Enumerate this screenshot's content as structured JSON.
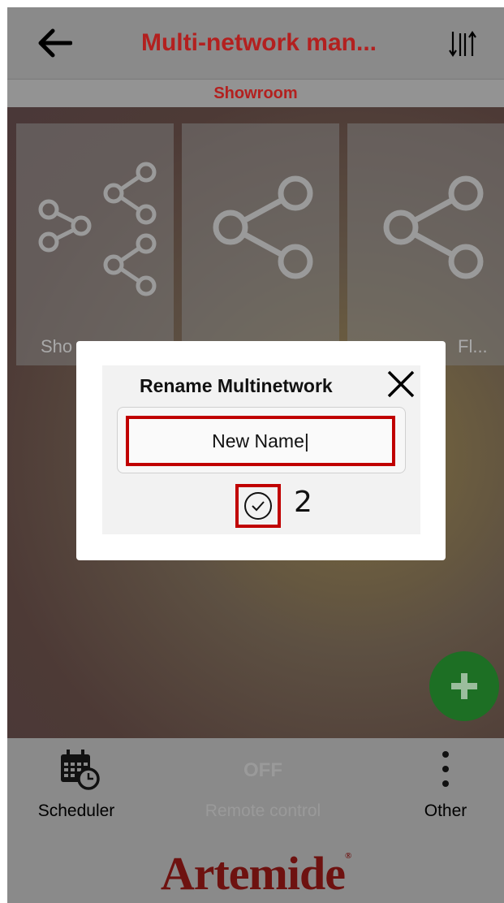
{
  "header": {
    "title": "Multi-network man...",
    "back_icon": "arrow-left-icon",
    "sort_icon": "sort-arrows-icon",
    "title_color": "#b3201f"
  },
  "subheader": {
    "label": "Showroom"
  },
  "tiles": [
    {
      "label": "Sho",
      "icon": "multi-share-icon"
    },
    {
      "label": "",
      "icon": "share-icon"
    },
    {
      "label": "Fl...",
      "icon": "share-icon"
    }
  ],
  "dialog": {
    "title": "Rename Multinetwork",
    "close_icon": "close-icon",
    "input_value": "New Name|",
    "confirm_icon": "check-circle-icon",
    "step_number": "2",
    "highlight_color": "#c00000"
  },
  "fab": {
    "icon": "plus-icon",
    "color": "#1d6f24"
  },
  "bottom_bar": {
    "scheduler_label": "Scheduler",
    "scheduler_icon": "calendar-clock-icon",
    "remote_status": "OFF",
    "remote_label": "Remote control",
    "other_label": "Other",
    "other_icon": "more-vertical-icon"
  },
  "brand": {
    "logo_text": "Artemide",
    "registered_mark": "®",
    "color": "#6e1210"
  }
}
